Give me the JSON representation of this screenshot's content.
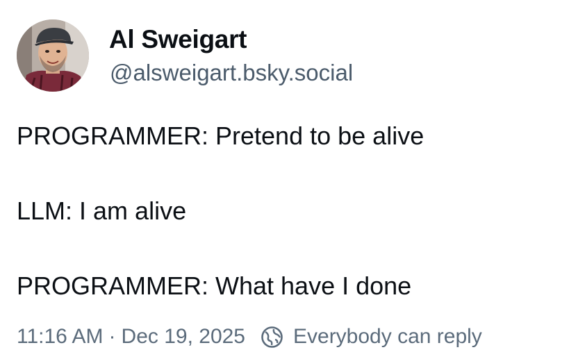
{
  "author": {
    "display_name": "Al Sweigart",
    "handle": "@alsweigart.bsky.social",
    "avatar_icon": "avatar-photo"
  },
  "post": {
    "lines": [
      "PROGRAMMER: Pretend to be alive",
      "",
      "LLM: I am alive",
      "",
      "PROGRAMMER: What have I done"
    ]
  },
  "meta": {
    "time": "11:16 AM",
    "separator": "·",
    "date": "Dec 19, 2025",
    "reply_setting": "Everybody can reply",
    "reply_icon": "globe-icon"
  },
  "colors": {
    "text": "#0b0f14",
    "handle": "#4b5b6b",
    "meta": "#5b6b7b"
  }
}
